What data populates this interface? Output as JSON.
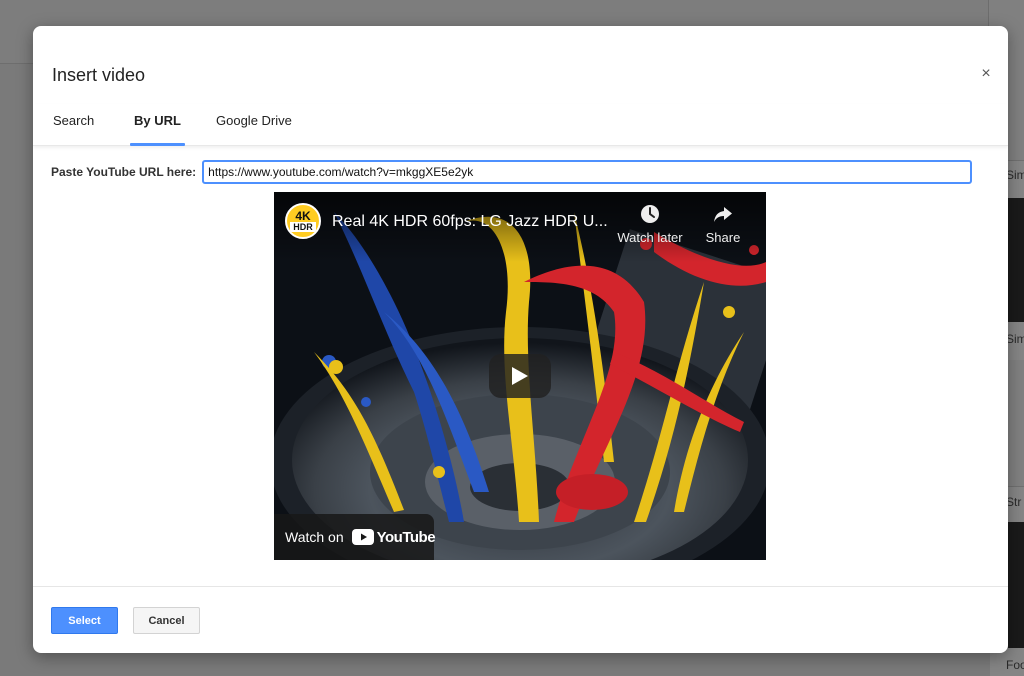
{
  "background": {
    "right_labels": [
      "Sim",
      "Sim",
      "Str",
      "Foo"
    ]
  },
  "dialog": {
    "title": "Insert video",
    "close_label": "×",
    "tabs": [
      {
        "label": "Search",
        "active": false
      },
      {
        "label": "By URL",
        "active": true
      },
      {
        "label": "Google Drive",
        "active": false
      }
    ],
    "url_label": "Paste YouTube URL here:",
    "url_value": "https://www.youtube.com/watch?v=mkggXE5e2yk",
    "video": {
      "channel_logo_top": "4K",
      "channel_logo_bottom": "HDR",
      "title": "Real 4K HDR 60fps: LG Jazz HDR U...",
      "watch_later_label": "Watch later",
      "share_label": "Share",
      "watch_on_label": "Watch on",
      "youtube_label": "YouTube"
    },
    "buttons": {
      "select_label": "Select",
      "cancel_label": "Cancel"
    }
  },
  "colors": {
    "accent": "#4d90fe",
    "overlay": "#727272"
  }
}
